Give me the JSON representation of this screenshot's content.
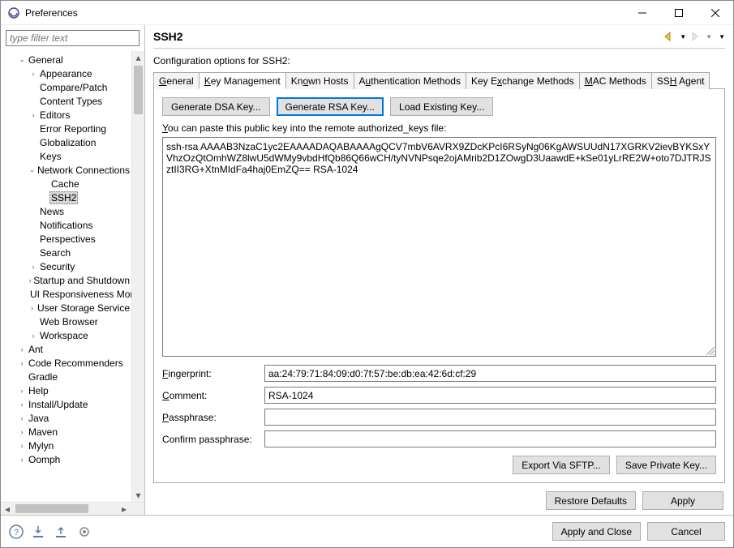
{
  "window": {
    "title": "Preferences"
  },
  "sidebar": {
    "filter_placeholder": "type filter text",
    "tree": [
      {
        "label": "General",
        "expanded": true,
        "children": [
          {
            "label": "Appearance",
            "hasChildren": true
          },
          {
            "label": "Compare/Patch"
          },
          {
            "label": "Content Types"
          },
          {
            "label": "Editors",
            "hasChildren": true
          },
          {
            "label": "Error Reporting"
          },
          {
            "label": "Globalization"
          },
          {
            "label": "Keys"
          },
          {
            "label": "Network Connections",
            "expanded": true,
            "children": [
              {
                "label": "Cache"
              },
              {
                "label": "SSH2",
                "selected": true
              }
            ]
          },
          {
            "label": "News"
          },
          {
            "label": "Notifications"
          },
          {
            "label": "Perspectives"
          },
          {
            "label": "Search"
          },
          {
            "label": "Security",
            "hasChildren": true
          },
          {
            "label": "Startup and Shutdown",
            "hasChildren": true
          },
          {
            "label": "UI Responsiveness Monitoring"
          },
          {
            "label": "User Storage Service",
            "hasChildren": true
          },
          {
            "label": "Web Browser"
          },
          {
            "label": "Workspace",
            "hasChildren": true
          }
        ]
      },
      {
        "label": "Ant",
        "hasChildren": true
      },
      {
        "label": "Code Recommenders",
        "hasChildren": true
      },
      {
        "label": "Gradle"
      },
      {
        "label": "Help",
        "hasChildren": true
      },
      {
        "label": "Install/Update",
        "hasChildren": true
      },
      {
        "label": "Java",
        "hasChildren": true
      },
      {
        "label": "Maven",
        "hasChildren": true
      },
      {
        "label": "Mylyn",
        "hasChildren": true
      },
      {
        "label": "Oomph",
        "hasChildren": true
      }
    ]
  },
  "main": {
    "heading": "SSH2",
    "description": "Configuration options for SSH2:",
    "tabs": [
      {
        "label": "General",
        "u": "G"
      },
      {
        "label": "Key Management",
        "u": "K",
        "active": true
      },
      {
        "label": "Known Hosts",
        "u": "o"
      },
      {
        "label": "Authentication Methods",
        "u": "u"
      },
      {
        "label": "Key Exchange Methods",
        "u": "x"
      },
      {
        "label": "MAC Methods",
        "u": "M"
      },
      {
        "label": "SSH Agent",
        "u": "H"
      }
    ],
    "buttons": {
      "gen_dsa": "Generate DSA Key...",
      "gen_rsa": "Generate RSA Key...",
      "load": "Load Existing Key..."
    },
    "hint_prefix": "Y",
    "hint_rest": "ou can paste this public key into the remote authorized_keys file:",
    "public_key": "ssh-rsa AAAAB3NzaC1yc2EAAAADAQABAAAAgQCV7mbV6AVRX9ZDcKPcI6RSyNg06KgAWSUUdN17XGRKV2ievBYKSxYVhzOzQtOmhWZ8lwU5dWMy9vbdHfQb86Q66wCH/tyNVNPsqe2ojAMrib2D1ZOwgD3UaawdE+kSe01yLrRE2W+oto7DJTRJSztII3RG+XtnMIdFa4haj0EmZQ== RSA-1024",
    "form": {
      "fingerprint_label": "Fingerprint:",
      "fingerprint_u": "F",
      "fingerprint_value": "aa:24:79:71:84:09:d0:7f:57:be:db:ea:42:6d:cf:29",
      "comment_label": "Comment:",
      "comment_u": "C",
      "comment_value": "RSA-1024",
      "passphrase_label": "Passphrase:",
      "passphrase_u": "P",
      "confirm_label": "Confirm passphrase:"
    },
    "keybtns": {
      "export": "Export Via SFTP...",
      "export_u": "E",
      "save": "Save Private Key...",
      "save_u": "S"
    },
    "restore": "Restore Defaults",
    "apply": "Apply",
    "apply_u": "A"
  },
  "footer": {
    "apply_close": "Apply and Close",
    "cancel": "Cancel"
  }
}
